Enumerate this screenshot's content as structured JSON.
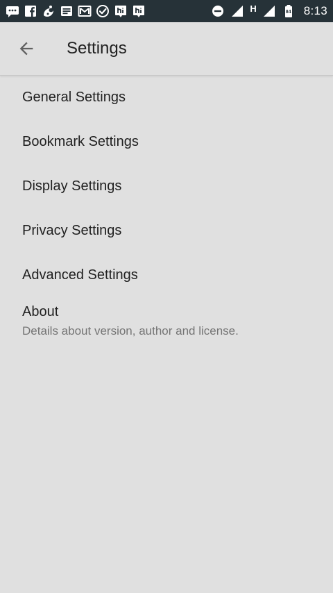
{
  "status_bar": {
    "clock": "8:13",
    "network_type": "H",
    "battery_level": "84",
    "icons_left": [
      "chat-icon",
      "facebook-icon",
      "uc-browser-icon",
      "news-icon",
      "mail-icon",
      "check-circle-icon",
      "hi-app-icon",
      "hi-app-icon"
    ],
    "icons_right": [
      "do-not-disturb-icon",
      "signal-icon",
      "signal-icon",
      "battery-icon"
    ],
    "background_color": "#263238"
  },
  "app_bar": {
    "title": "Settings",
    "back_icon": "arrow-back-icon"
  },
  "settings": {
    "items": [
      {
        "label": "General Settings"
      },
      {
        "label": "Bookmark Settings"
      },
      {
        "label": "Display Settings"
      },
      {
        "label": "Privacy Settings"
      },
      {
        "label": "Advanced Settings"
      }
    ],
    "about": {
      "label": "About",
      "summary": "Details about version, author and license."
    }
  },
  "colors": {
    "background": "#e0e0e0",
    "primary_text": "#212121",
    "secondary_text": "#757575"
  }
}
